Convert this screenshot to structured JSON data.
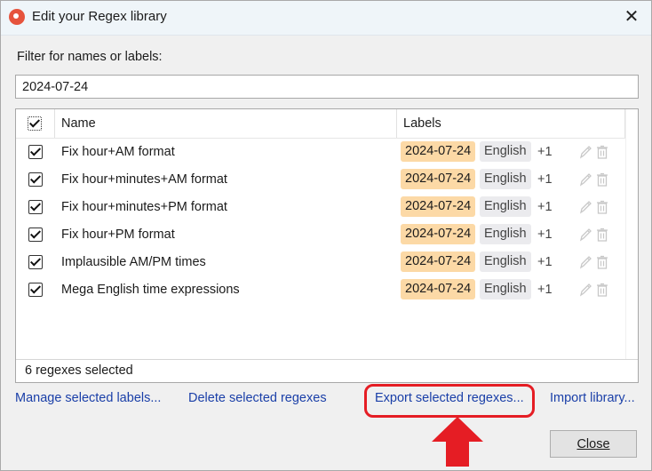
{
  "window": {
    "title": "Edit your Regex library",
    "close_glyph": "✕"
  },
  "filter": {
    "label": "Filter for names or labels:",
    "value": "2024-07-24"
  },
  "list": {
    "columns": {
      "name": "Name",
      "labels": "Labels"
    },
    "rows": [
      {
        "name": "Fix hour+AM format",
        "date_label": "2024-07-24",
        "lang_label": "English",
        "more": "+1",
        "checked": true
      },
      {
        "name": "Fix hour+minutes+AM format",
        "date_label": "2024-07-24",
        "lang_label": "English",
        "more": "+1",
        "checked": true
      },
      {
        "name": "Fix hour+minutes+PM format",
        "date_label": "2024-07-24",
        "lang_label": "English",
        "more": "+1",
        "checked": true
      },
      {
        "name": "Fix hour+PM format",
        "date_label": "2024-07-24",
        "lang_label": "English",
        "more": "+1",
        "checked": true
      },
      {
        "name": "Implausible AM/PM times",
        "date_label": "2024-07-24",
        "lang_label": "English",
        "more": "+1",
        "checked": true
      },
      {
        "name": "Mega English time expressions",
        "date_label": "2024-07-24",
        "lang_label": "English",
        "more": "+1",
        "checked": true
      }
    ],
    "status": "6 regexes selected"
  },
  "actions": {
    "manage_labels": "Manage selected labels...",
    "delete": "Delete selected regexes",
    "export": "Export selected regexes...",
    "import": "Import library..."
  },
  "close_button": "Close",
  "colors": {
    "accent_link": "#1a3fa8",
    "date_tag": "#fcd9a6",
    "lang_tag": "#ebebee",
    "highlight": "#e51d24"
  }
}
